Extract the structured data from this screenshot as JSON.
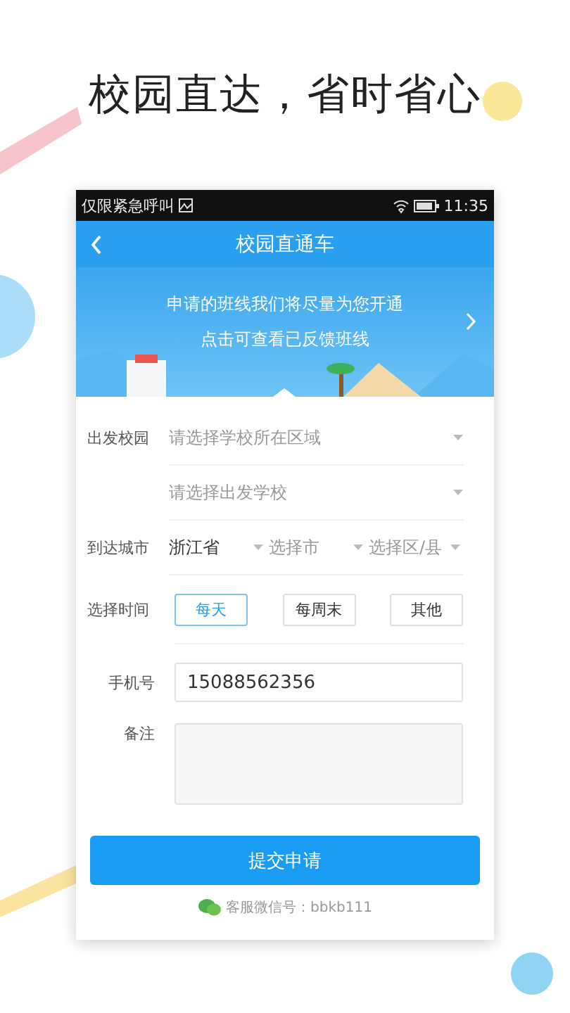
{
  "headline": "校园直达，省时省心",
  "status_bar": {
    "carrier": "仅限紧急呼叫",
    "time": "11:35"
  },
  "nav": {
    "title": "校园直通车"
  },
  "banner": {
    "lines": [
      "申请的班线我们将尽量为您开通",
      "点击可查看已反馈班线"
    ]
  },
  "form": {
    "departure": {
      "label": "出发校园",
      "selects": [
        {
          "placeholder": "请选择学校所在区域"
        },
        {
          "placeholder": "请选择出发学校"
        }
      ]
    },
    "destination": {
      "label": "到达城市",
      "selects": [
        {
          "value": "浙江省"
        },
        {
          "placeholder": "选择市"
        },
        {
          "placeholder": "选择区/县"
        }
      ]
    },
    "time": {
      "label": "选择时间",
      "options": [
        {
          "label": "每天",
          "selected": true
        },
        {
          "label": "每周末",
          "selected": false
        },
        {
          "label": "其他",
          "selected": false
        }
      ]
    },
    "phone": {
      "label": "手机号",
      "value": "15088562356"
    },
    "notes": {
      "label": "备注"
    }
  },
  "submit": "提交申请",
  "footer": "客服微信号：bbkb111"
}
